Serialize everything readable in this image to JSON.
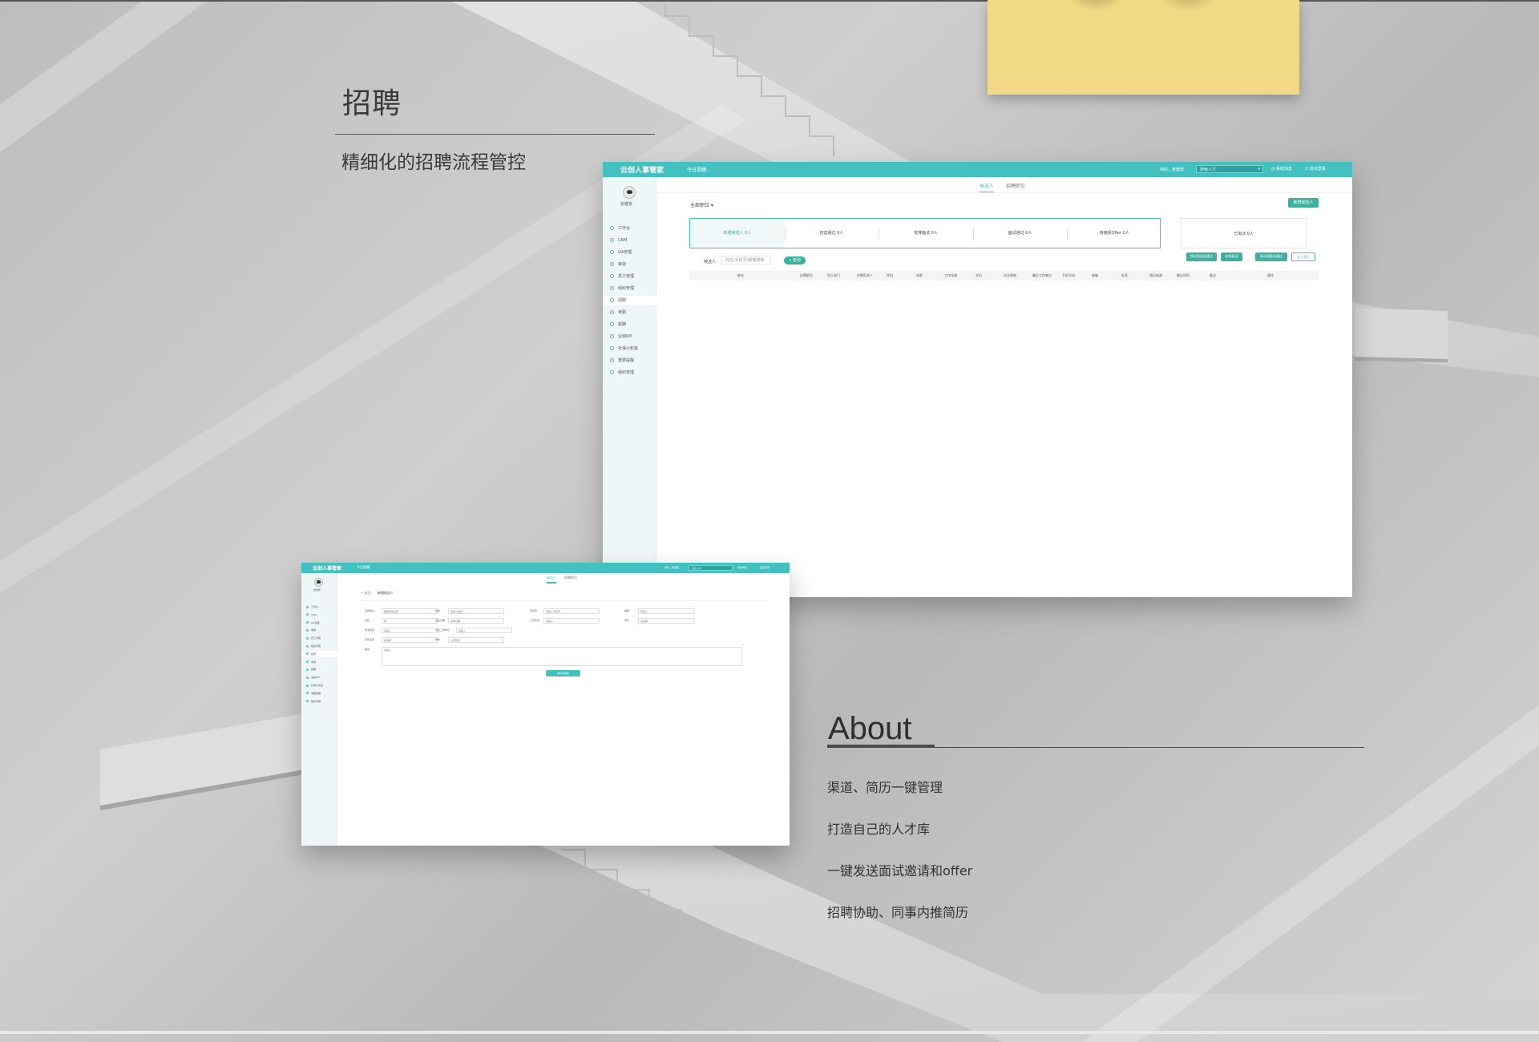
{
  "section": {
    "title": "招聘",
    "subtitle": "精细化的招聘流程管控"
  },
  "about": {
    "heading": "About",
    "features": [
      "渠道、简历一键管理",
      "打造自己的人才库",
      "一键发送面试邀请和offer",
      "招聘协助、同事内推简历"
    ]
  },
  "main_window": {
    "logo": "云创人事管家",
    "today_label": "今日提醒:",
    "greeting": "你好，张健安",
    "search_placeholder": "搜索人才",
    "notice": "系统消息",
    "logout": "退出登录",
    "user": "张健安",
    "sidebar": [
      "工作台",
      "CRM",
      "OA管理",
      "审批",
      "员工管理",
      "组织管理",
      "招聘",
      "考勤",
      "薪酬",
      "业绩KPI",
      "社保公积金",
      "重要提醒",
      "组织管理"
    ],
    "active_sidebar": "招聘",
    "tabs": [
      "候选人",
      "招聘职位"
    ],
    "filter": "全部职位 ▾",
    "new_button": "新增候选人",
    "stages": [
      "新增候选人 0人",
      "初选通过 0人",
      "安排面试 0人",
      "面试通过 0人",
      "待接受Offer 0人"
    ],
    "eliminated": "已淘汰 0人",
    "search_label": "候选人",
    "search_input": "姓名/手机号/邮箱搜索",
    "search_button": "查询",
    "actions": [
      "移动到初选通过",
      "安排面试",
      "移动到面试通过",
      "导入简历"
    ],
    "columns": [
      "姓名",
      "应聘职位",
      "用人部门",
      "应聘负责人",
      "性别",
      "年龄",
      "工作年限",
      "学历",
      "毕业院校",
      "最近工作单位",
      "手机号码",
      "邮箱",
      "标签",
      "简历来源",
      "最后时间",
      "备注",
      "操作"
    ]
  },
  "form_window": {
    "logo": "云创人事管家",
    "today_label": "今日提醒:",
    "greeting": "你好，张健安",
    "search_placeholder": "搜索人才",
    "notice": "系统消息",
    "logout": "退出登录",
    "user": "张健安",
    "sidebar": [
      "工作台",
      "CRM",
      "OA管理",
      "审批",
      "员工管理",
      "组织管理",
      "招聘",
      "考勤",
      "薪酬",
      "业绩KPI",
      "社保公积金",
      "重要提醒",
      "组织管理"
    ],
    "tabs": [
      "候选人",
      "招聘职位"
    ],
    "breadcrumb_back": "< 返回",
    "breadcrumb_title": "新增候选人",
    "fields": [
      {
        "label": "应聘职位",
        "value": "招聘职位名称"
      },
      {
        "label": "姓名",
        "value": "请输入姓名"
      },
      {
        "label": "手机号",
        "value": "请输入手机号"
      },
      {
        "label": "邮箱",
        "value": "请输入"
      },
      {
        "label": "性别",
        "value": "男"
      },
      {
        "label": "出生日期",
        "value": "选择日期"
      },
      {
        "label": "工作年限",
        "value": "请输入"
      },
      {
        "label": "学历",
        "value": "请选择"
      },
      {
        "label": "毕业院校",
        "value": "请输入"
      },
      {
        "label": "最近工作单位",
        "value": "请输入"
      },
      {
        "label": "简历来源",
        "value": "请选择"
      },
      {
        "label": "附件",
        "value": "上传附件"
      },
      {
        "label": "备注",
        "value": "请输入"
      }
    ],
    "save_button": "保存并添加"
  }
}
